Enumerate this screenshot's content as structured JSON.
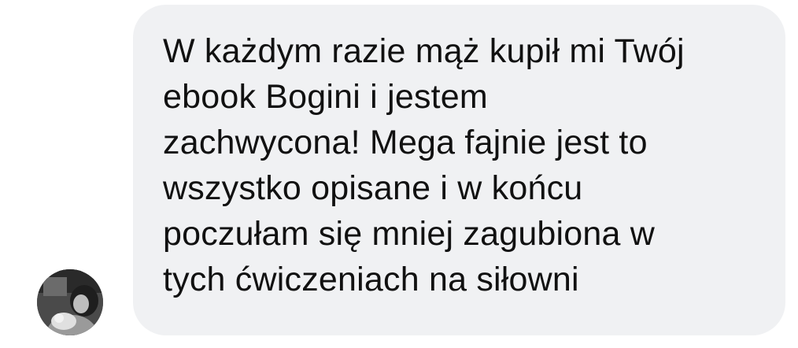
{
  "conversation": {
    "sender": {
      "avatar_icon": "user-photo-avatar"
    },
    "message": {
      "text": "W każdym razie mąż kupił mi Twój\nebook Bogini i jestem\nzachwycona! Mega fajnie jest to\nwszystko opisane i w końcu\npoczułam się mniej zagubiona w\ntych ćwiczeniach na siłowni"
    }
  },
  "colors": {
    "bubble_background": "#f0f1f3",
    "text": "#111111",
    "page_background": "#ffffff"
  }
}
